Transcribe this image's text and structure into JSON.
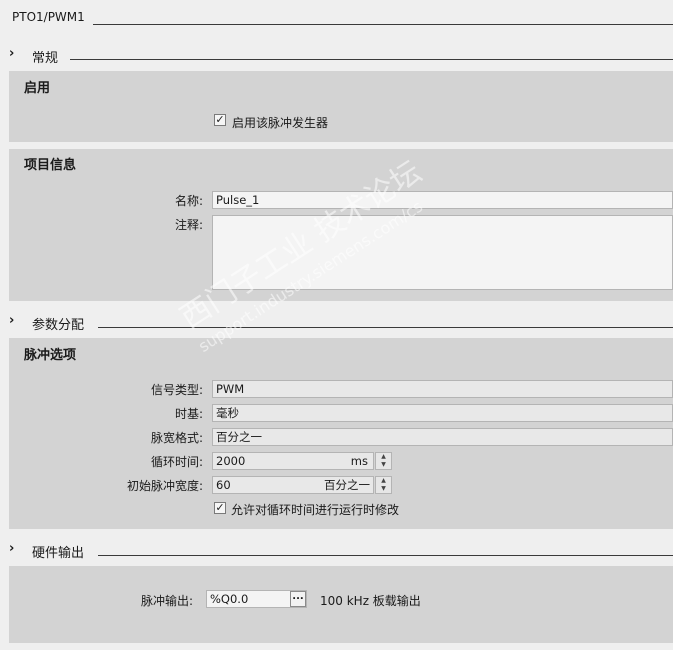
{
  "header": {
    "title": "PTO1/PWM1"
  },
  "sections": {
    "general": "常规",
    "params": "参数分配",
    "hardware": "硬件输出"
  },
  "enable": {
    "title": "启用",
    "checkbox_label": "启用该脉冲发生器",
    "checked": true
  },
  "project_info": {
    "title": "项目信息",
    "name_label": "名称:",
    "name_value": "Pulse_1",
    "comment_label": "注释:",
    "comment_value": ""
  },
  "pulse_options": {
    "title": "脉冲选项",
    "signal_type_label": "信号类型:",
    "signal_type_value": "PWM",
    "timebase_label": "时基:",
    "timebase_value": "毫秒",
    "pulse_format_label": "脉宽格式:",
    "pulse_format_value": "百分之一",
    "cycle_time_label": "循环时间:",
    "cycle_time_value": "2000",
    "cycle_time_unit": "ms",
    "initial_width_label": "初始脉冲宽度:",
    "initial_width_value": "60",
    "initial_width_unit": "百分之一",
    "runtime_mod_label": "允许对循环时间进行运行时修改",
    "runtime_mod_checked": true
  },
  "hardware_output": {
    "pulse_output_label": "脉冲输出:",
    "pulse_output_value": "%Q0.0",
    "browse_label": "...",
    "output_desc": "100 kHz 板载输出"
  },
  "watermark": {
    "line1": "西门子工业 技术论坛",
    "line2": "support.industry.siemens.com/cs"
  }
}
